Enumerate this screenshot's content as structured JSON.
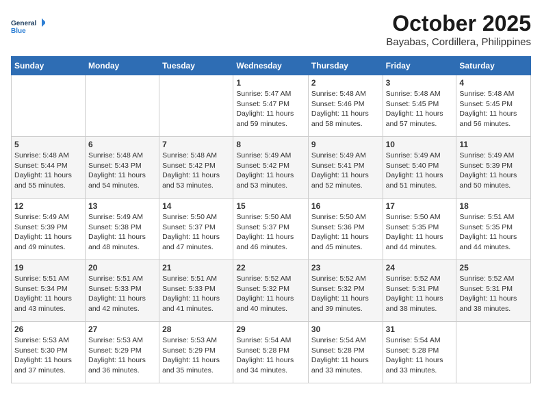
{
  "logo": {
    "text_general": "General",
    "text_blue": "Blue"
  },
  "title": "October 2025",
  "subtitle": "Bayabas, Cordillera, Philippines",
  "weekdays": [
    "Sunday",
    "Monday",
    "Tuesday",
    "Wednesday",
    "Thursday",
    "Friday",
    "Saturday"
  ],
  "weeks": [
    [
      {
        "day": "",
        "info": ""
      },
      {
        "day": "",
        "info": ""
      },
      {
        "day": "",
        "info": ""
      },
      {
        "day": "1",
        "info": "Sunrise: 5:47 AM\nSunset: 5:47 PM\nDaylight: 11 hours and 59 minutes."
      },
      {
        "day": "2",
        "info": "Sunrise: 5:48 AM\nSunset: 5:46 PM\nDaylight: 11 hours and 58 minutes."
      },
      {
        "day": "3",
        "info": "Sunrise: 5:48 AM\nSunset: 5:45 PM\nDaylight: 11 hours and 57 minutes."
      },
      {
        "day": "4",
        "info": "Sunrise: 5:48 AM\nSunset: 5:45 PM\nDaylight: 11 hours and 56 minutes."
      }
    ],
    [
      {
        "day": "5",
        "info": "Sunrise: 5:48 AM\nSunset: 5:44 PM\nDaylight: 11 hours and 55 minutes."
      },
      {
        "day": "6",
        "info": "Sunrise: 5:48 AM\nSunset: 5:43 PM\nDaylight: 11 hours and 54 minutes."
      },
      {
        "day": "7",
        "info": "Sunrise: 5:48 AM\nSunset: 5:42 PM\nDaylight: 11 hours and 53 minutes."
      },
      {
        "day": "8",
        "info": "Sunrise: 5:49 AM\nSunset: 5:42 PM\nDaylight: 11 hours and 53 minutes."
      },
      {
        "day": "9",
        "info": "Sunrise: 5:49 AM\nSunset: 5:41 PM\nDaylight: 11 hours and 52 minutes."
      },
      {
        "day": "10",
        "info": "Sunrise: 5:49 AM\nSunset: 5:40 PM\nDaylight: 11 hours and 51 minutes."
      },
      {
        "day": "11",
        "info": "Sunrise: 5:49 AM\nSunset: 5:39 PM\nDaylight: 11 hours and 50 minutes."
      }
    ],
    [
      {
        "day": "12",
        "info": "Sunrise: 5:49 AM\nSunset: 5:39 PM\nDaylight: 11 hours and 49 minutes."
      },
      {
        "day": "13",
        "info": "Sunrise: 5:49 AM\nSunset: 5:38 PM\nDaylight: 11 hours and 48 minutes."
      },
      {
        "day": "14",
        "info": "Sunrise: 5:50 AM\nSunset: 5:37 PM\nDaylight: 11 hours and 47 minutes."
      },
      {
        "day": "15",
        "info": "Sunrise: 5:50 AM\nSunset: 5:37 PM\nDaylight: 11 hours and 46 minutes."
      },
      {
        "day": "16",
        "info": "Sunrise: 5:50 AM\nSunset: 5:36 PM\nDaylight: 11 hours and 45 minutes."
      },
      {
        "day": "17",
        "info": "Sunrise: 5:50 AM\nSunset: 5:35 PM\nDaylight: 11 hours and 44 minutes."
      },
      {
        "day": "18",
        "info": "Sunrise: 5:51 AM\nSunset: 5:35 PM\nDaylight: 11 hours and 44 minutes."
      }
    ],
    [
      {
        "day": "19",
        "info": "Sunrise: 5:51 AM\nSunset: 5:34 PM\nDaylight: 11 hours and 43 minutes."
      },
      {
        "day": "20",
        "info": "Sunrise: 5:51 AM\nSunset: 5:33 PM\nDaylight: 11 hours and 42 minutes."
      },
      {
        "day": "21",
        "info": "Sunrise: 5:51 AM\nSunset: 5:33 PM\nDaylight: 11 hours and 41 minutes."
      },
      {
        "day": "22",
        "info": "Sunrise: 5:52 AM\nSunset: 5:32 PM\nDaylight: 11 hours and 40 minutes."
      },
      {
        "day": "23",
        "info": "Sunrise: 5:52 AM\nSunset: 5:32 PM\nDaylight: 11 hours and 39 minutes."
      },
      {
        "day": "24",
        "info": "Sunrise: 5:52 AM\nSunset: 5:31 PM\nDaylight: 11 hours and 38 minutes."
      },
      {
        "day": "25",
        "info": "Sunrise: 5:52 AM\nSunset: 5:31 PM\nDaylight: 11 hours and 38 minutes."
      }
    ],
    [
      {
        "day": "26",
        "info": "Sunrise: 5:53 AM\nSunset: 5:30 PM\nDaylight: 11 hours and 37 minutes."
      },
      {
        "day": "27",
        "info": "Sunrise: 5:53 AM\nSunset: 5:29 PM\nDaylight: 11 hours and 36 minutes."
      },
      {
        "day": "28",
        "info": "Sunrise: 5:53 AM\nSunset: 5:29 PM\nDaylight: 11 hours and 35 minutes."
      },
      {
        "day": "29",
        "info": "Sunrise: 5:54 AM\nSunset: 5:28 PM\nDaylight: 11 hours and 34 minutes."
      },
      {
        "day": "30",
        "info": "Sunrise: 5:54 AM\nSunset: 5:28 PM\nDaylight: 11 hours and 33 minutes."
      },
      {
        "day": "31",
        "info": "Sunrise: 5:54 AM\nSunset: 5:28 PM\nDaylight: 11 hours and 33 minutes."
      },
      {
        "day": "",
        "info": ""
      }
    ]
  ]
}
